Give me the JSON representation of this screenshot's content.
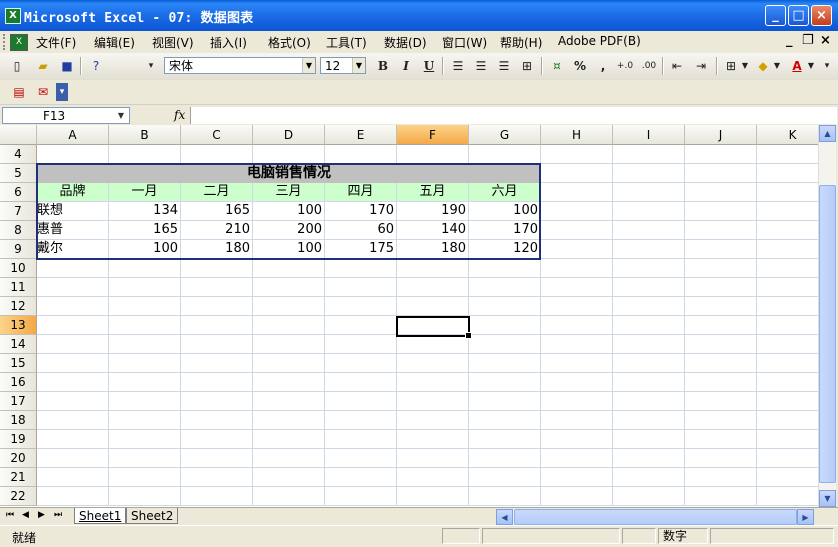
{
  "window": {
    "title": "Microsoft Excel - 07: 数据图表",
    "app_icon": "excel-icon",
    "buttons": {
      "minimize": "_",
      "maximize": "□",
      "close": "×"
    }
  },
  "menubar": {
    "items": [
      "文件(F)",
      "编辑(E)",
      "视图(V)",
      "插入(I)",
      "格式(O)",
      "工具(T)",
      "数据(D)",
      "窗口(W)",
      "帮助(H)",
      "Adobe PDF(B)"
    ],
    "mdi": {
      "minimize": "_",
      "restore": "❐",
      "close": "×"
    }
  },
  "toolbar": {
    "font_name": "宋体",
    "font_size": "12",
    "bold": "B",
    "italic": "I",
    "underline": "U",
    "percent": "%",
    "comma": ",",
    "increase_decimal": "+.0",
    "decrease_decimal": ".00",
    "font_color": "A",
    "icons": [
      "new-icon",
      "open-icon",
      "save-icon",
      "help-icon",
      "align-left-icon",
      "align-center-icon",
      "align-right-icon",
      "merge-center-icon",
      "currency-icon",
      "outdent-icon",
      "indent-icon",
      "borders-icon",
      "fill-color-icon",
      "font-color-icon"
    ]
  },
  "toolbar2": {
    "icons": [
      "pdf-convert-icon",
      "pdf-email-icon"
    ]
  },
  "formula_bar": {
    "name_box": "F13",
    "fx_label": "fx",
    "formula": ""
  },
  "sheet": {
    "columns": [
      "A",
      "B",
      "C",
      "D",
      "E",
      "F",
      "G",
      "H",
      "I",
      "J",
      "K"
    ],
    "active_column": "F",
    "rows": [
      "4",
      "5",
      "6",
      "7",
      "8",
      "9",
      "10",
      "11",
      "12",
      "13",
      "14",
      "15",
      "16",
      "17",
      "18",
      "19",
      "20",
      "21",
      "22"
    ],
    "active_row": "13",
    "table_title": "电脑销售情况",
    "table_headers": [
      "品牌",
      "一月",
      "二月",
      "三月",
      "四月",
      "五月",
      "六月"
    ],
    "table_rows": [
      [
        "联想",
        "134",
        "165",
        "100",
        "170",
        "190",
        "100"
      ],
      [
        "惠普",
        "165",
        "210",
        "200",
        "60",
        "140",
        "170"
      ],
      [
        "戴尔",
        "100",
        "180",
        "100",
        "175",
        "180",
        "120"
      ]
    ],
    "colors": {
      "title_fill": "#c0c0c0",
      "header_fill": "#ccffcc",
      "table_border": "#1f2f7a",
      "active_header": "#f5a846"
    }
  },
  "sheet_tabs": {
    "nav": [
      "⏮",
      "◀",
      "▶",
      "⏭"
    ],
    "tabs": [
      "Sheet1",
      "Sheet2"
    ],
    "active": "Sheet1"
  },
  "status": {
    "left": "就绪",
    "mode": "数字"
  }
}
